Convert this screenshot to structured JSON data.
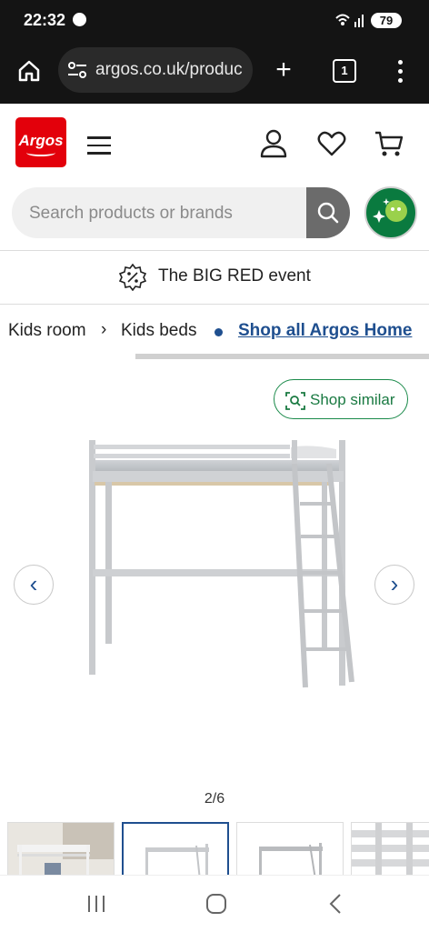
{
  "status": {
    "time": "22:32",
    "battery": "79"
  },
  "browser": {
    "url": "argos.co.uk/produc",
    "tab_count": "1"
  },
  "header": {
    "logo_text": "Argos"
  },
  "search": {
    "placeholder": "Search products or brands"
  },
  "banner": {
    "text": "The BIG RED event"
  },
  "breadcrumbs": {
    "items": [
      "Kids room",
      "Kids beds"
    ],
    "shop_all": "Shop all Argos Home"
  },
  "gallery": {
    "shop_similar": "Shop similar",
    "counter": "2/6",
    "current": 2,
    "total": 6
  },
  "colors": {
    "brand_red": "#e3000b",
    "link_blue": "#1f4f8f",
    "similar_green": "#1a7a42"
  }
}
